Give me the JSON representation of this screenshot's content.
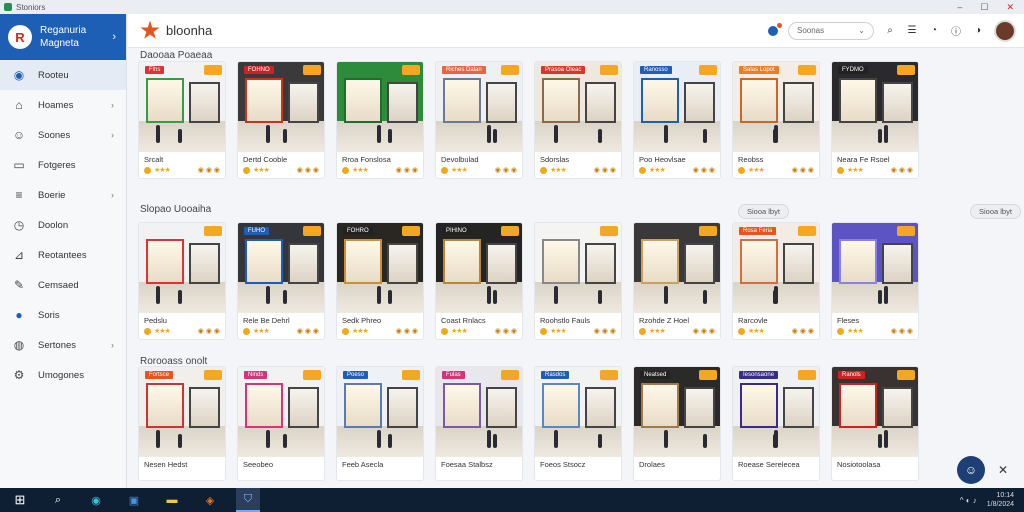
{
  "window": {
    "title": "Stoniors",
    "controls": [
      "–",
      "☐",
      "✕"
    ]
  },
  "sidebar": {
    "brand_line1": "Reganuria",
    "brand_line2": "Magneta",
    "items": [
      {
        "label": "Rooteu",
        "icon": "camera-icon",
        "glyph": "◉",
        "arrow": ""
      },
      {
        "label": "Hoames",
        "icon": "home-icon",
        "glyph": "⌂",
        "arrow": "›"
      },
      {
        "label": "Soones",
        "icon": "user-icon",
        "glyph": "☺",
        "arrow": "›"
      },
      {
        "label": "Fotgeres",
        "icon": "folder-icon",
        "glyph": "▭",
        "arrow": ""
      },
      {
        "label": "Boerie",
        "icon": "list-icon",
        "glyph": "≡",
        "arrow": "›"
      },
      {
        "label": "Doolon",
        "icon": "clock-icon",
        "glyph": "◷",
        "arrow": ""
      },
      {
        "label": "Reotantees",
        "icon": "chart-icon",
        "glyph": "⊿",
        "arrow": ""
      },
      {
        "label": "Cemsaed",
        "icon": "edit-icon",
        "glyph": "✎",
        "arrow": ""
      },
      {
        "label": "Soris",
        "icon": "info-icon",
        "glyph": "●",
        "arrow": ""
      },
      {
        "label": "Sertones",
        "icon": "globe-icon",
        "glyph": "◍",
        "arrow": "›"
      },
      {
        "label": "Umogones",
        "icon": "settings-icon",
        "glyph": "⚙",
        "arrow": ""
      }
    ]
  },
  "topbar": {
    "app_name": "bloonha",
    "search_placeholder": "Soonas",
    "search_chevron": "⌄"
  },
  "sections": [
    {
      "title": "Daooaa Poaeaa",
      "see_all": "",
      "cards": [
        {
          "name": "Srcalt",
          "price": "◉ ◉ ◉",
          "sign": "Flhs",
          "sign_color": "#d33",
          "wall": "#f2f2f2",
          "accent": "#3a9b45"
        },
        {
          "name": "Dertd Cooble",
          "price": "◉ ◉ ◉",
          "sign": "FOHNO",
          "sign_color": "#c22",
          "wall": "#3a3a3a",
          "accent": "#c8351f"
        },
        {
          "name": "Rroa Fonslosa",
          "price": "◉ ◉ ◉",
          "sign": "",
          "sign_color": "#2a8b3a",
          "wall": "#2d8b3c",
          "accent": "#1f6e2d"
        },
        {
          "name": "Devolbulad",
          "price": "◉ ◉ ◉",
          "sign": "Riches Dalan",
          "sign_color": "#e8653d",
          "wall": "#eef0f3",
          "accent": "#6a7a90"
        },
        {
          "name": "Sdorslas",
          "price": "◉ ◉ ◉",
          "sign": "Prasoa Oleac",
          "sign_color": "#d43a2a",
          "wall": "#efe8df",
          "accent": "#8a6a4a"
        },
        {
          "name": "Poo Heovlsae",
          "price": "◉ ◉ ◉",
          "sign": "Ranosso",
          "sign_color": "#1d5fb4",
          "wall": "#e9edf5",
          "accent": "#1d5fb4"
        },
        {
          "name": "Reobss",
          "price": "◉ ◉ ◉",
          "sign": "Salas Lopot",
          "sign_color": "#ea7d25",
          "wall": "#f3ede6",
          "accent": "#c9662a"
        },
        {
          "name": "Neara Fe Rsoel",
          "price": "◉ ◉ ◉",
          "sign": "FYDMO",
          "sign_color": "#222",
          "wall": "#2a2a2e",
          "accent": "#444"
        }
      ]
    },
    {
      "title": "Slopao Uooaiha",
      "see_all": "Siooa lbyt",
      "cards": [
        {
          "name": "Pedslu",
          "price": "◉ ◉ ◉",
          "sign": "",
          "sign_color": "#c22",
          "wall": "#f1f2f4",
          "accent": "#d33"
        },
        {
          "name": "Rele Be Dehrl",
          "price": "◉ ◉ ◉",
          "sign": "FUHO",
          "sign_color": "#1d5fb4",
          "wall": "#34363b",
          "accent": "#1d5fb4"
        },
        {
          "name": "Sedk Phreo",
          "price": "◉ ◉ ◉",
          "sign": "FOHRO",
          "sign_color": "#222",
          "wall": "#2a2622",
          "accent": "#c98f3a"
        },
        {
          "name": "Coast Rnlacs",
          "price": "◉ ◉ ◉",
          "sign": "PIHINO",
          "sign_color": "#222",
          "wall": "#242424",
          "accent": "#b8863a"
        },
        {
          "name": "Roohstlo Fauls",
          "price": "◉ ◉ ◉",
          "sign": "",
          "sign_color": "#ea7d25",
          "wall": "#f4f4f2",
          "accent": "#888"
        },
        {
          "name": "Rzohde Z Hoel",
          "price": "◉ ◉ ◉",
          "sign": "",
          "sign_color": "#333",
          "wall": "#3a3838",
          "accent": "#c8a060"
        },
        {
          "name": "Rarcovle",
          "price": "◉ ◉ ◉",
          "sign": "Rosa Feria",
          "sign_color": "#e8531e",
          "wall": "#f3ece4",
          "accent": "#d07040"
        },
        {
          "name": "Fleses",
          "price": "◉ ◉ ◉",
          "sign": "",
          "sign_color": "#5a4ab0",
          "wall": "#5b54c2",
          "accent": "#8a82e0"
        }
      ]
    },
    {
      "title": "Rorooass onolt",
      "see_all": "",
      "cards": [
        {
          "name": "Nesen Hedst",
          "price": "",
          "sign": "Fortsce",
          "sign_color": "#e8531e",
          "wall": "#f1efec",
          "accent": "#c33"
        },
        {
          "name": "Seeobeo",
          "price": "",
          "sign": "Ninds",
          "sign_color": "#d6337a",
          "wall": "#f2f2f2",
          "accent": "#d6337a"
        },
        {
          "name": "Feeb Asecla",
          "price": "",
          "sign": "Poeso",
          "sign_color": "#1d5fb4",
          "wall": "#eef1f6",
          "accent": "#5a7ab0"
        },
        {
          "name": "Foesaa Stalbsz",
          "price": "",
          "sign": "Fulas",
          "sign_color": "#d6337a",
          "wall": "#e9e7ee",
          "accent": "#7a5aa0"
        },
        {
          "name": "Foeos Stsocz",
          "price": "",
          "sign": "Rasdos",
          "sign_color": "#1d5fb4",
          "wall": "#f0f2f4",
          "accent": "#5a88c0"
        },
        {
          "name": "Drolaes",
          "price": "",
          "sign": "Neatsed",
          "sign_color": "#222",
          "wall": "#2c2a28",
          "accent": "#a07a4a"
        },
        {
          "name": "Roease Serelecea",
          "price": "",
          "sign": "Iesonsaone",
          "sign_color": "#3a2a8a",
          "wall": "#eef0f3",
          "accent": "#3a2a8a"
        },
        {
          "name": "Nosiotoolasa",
          "price": "",
          "sign": "Ranols",
          "sign_color": "#c22",
          "wall": "#3a3230",
          "accent": "#c22"
        }
      ]
    }
  ],
  "taskbar": {
    "time": "10:14",
    "date": "1/8/2024",
    "tray_text": "^ ◐ ♪"
  },
  "colors": {
    "accent": "#1d5fb4",
    "star": "#f0a81c"
  }
}
